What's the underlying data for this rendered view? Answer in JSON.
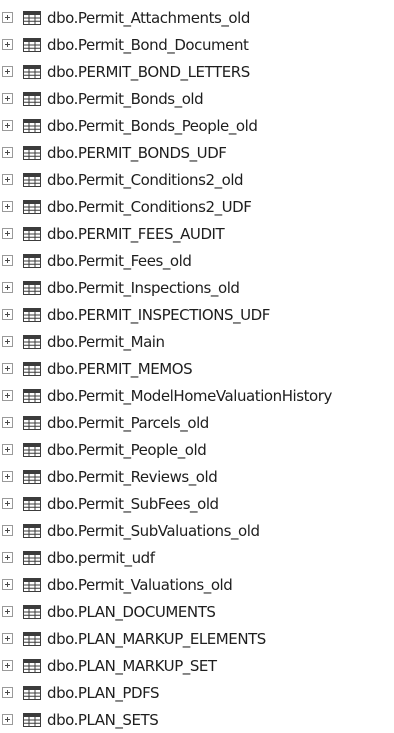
{
  "tree": {
    "items": [
      {
        "label": "dbo.Permit_Attachments_old",
        "icon": "table-icon",
        "expander": "plus"
      },
      {
        "label": "dbo.Permit_Bond_Document",
        "icon": "table-icon",
        "expander": "plus"
      },
      {
        "label": "dbo.PERMIT_BOND_LETTERS",
        "icon": "table-icon",
        "expander": "plus"
      },
      {
        "label": "dbo.Permit_Bonds_old",
        "icon": "table-icon",
        "expander": "plus"
      },
      {
        "label": "dbo.Permit_Bonds_People_old",
        "icon": "table-icon",
        "expander": "plus"
      },
      {
        "label": "dbo.PERMIT_BONDS_UDF",
        "icon": "table-icon",
        "expander": "plus"
      },
      {
        "label": "dbo.Permit_Conditions2_old",
        "icon": "table-icon",
        "expander": "plus"
      },
      {
        "label": "dbo.Permit_Conditions2_UDF",
        "icon": "table-icon",
        "expander": "plus"
      },
      {
        "label": "dbo.PERMIT_FEES_AUDIT",
        "icon": "table-icon",
        "expander": "plus"
      },
      {
        "label": "dbo.Permit_Fees_old",
        "icon": "table-icon",
        "expander": "plus"
      },
      {
        "label": "dbo.Permit_Inspections_old",
        "icon": "table-icon",
        "expander": "plus"
      },
      {
        "label": "dbo.PERMIT_INSPECTIONS_UDF",
        "icon": "table-icon",
        "expander": "plus"
      },
      {
        "label": "dbo.Permit_Main",
        "icon": "table-icon",
        "expander": "plus"
      },
      {
        "label": "dbo.PERMIT_MEMOS",
        "icon": "table-icon",
        "expander": "plus"
      },
      {
        "label": "dbo.Permit_ModelHomeValuationHistory",
        "icon": "table-icon",
        "expander": "plus"
      },
      {
        "label": "dbo.Permit_Parcels_old",
        "icon": "table-icon",
        "expander": "plus"
      },
      {
        "label": "dbo.Permit_People_old",
        "icon": "table-icon",
        "expander": "plus"
      },
      {
        "label": "dbo.Permit_Reviews_old",
        "icon": "table-icon",
        "expander": "plus"
      },
      {
        "label": "dbo.Permit_SubFees_old",
        "icon": "table-icon",
        "expander": "plus"
      },
      {
        "label": "dbo.Permit_SubValuations_old",
        "icon": "table-icon",
        "expander": "plus"
      },
      {
        "label": "dbo.permit_udf",
        "icon": "table-icon",
        "expander": "plus"
      },
      {
        "label": "dbo.Permit_Valuations_old",
        "icon": "table-icon",
        "expander": "plus"
      },
      {
        "label": "dbo.PLAN_DOCUMENTS",
        "icon": "table-icon",
        "expander": "plus"
      },
      {
        "label": "dbo.PLAN_MARKUP_ELEMENTS",
        "icon": "table-icon",
        "expander": "plus"
      },
      {
        "label": "dbo.PLAN_MARKUP_SET",
        "icon": "table-icon",
        "expander": "plus"
      },
      {
        "label": "dbo.PLAN_PDFS",
        "icon": "table-icon",
        "expander": "plus"
      },
      {
        "label": "dbo.PLAN_SETS",
        "icon": "table-icon",
        "expander": "plus"
      }
    ],
    "colors": {
      "text": "#1e1e1e",
      "expander_border": "#9a9a9a",
      "table_icon_header": "#3c3c3c",
      "table_icon_body": "#ffffff"
    }
  }
}
